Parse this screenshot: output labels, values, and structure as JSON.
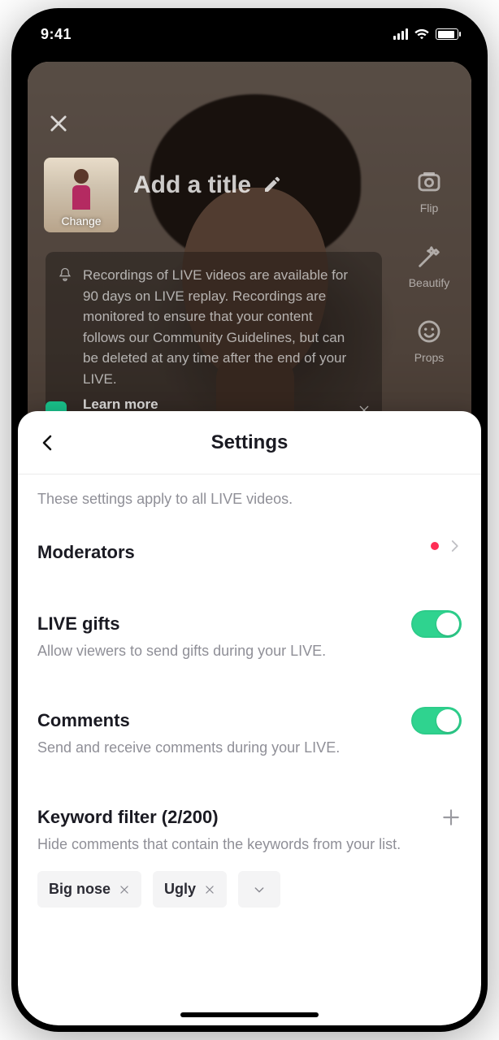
{
  "statusbar": {
    "time": "9:41"
  },
  "camera": {
    "thumb_label": "Change",
    "title_placeholder": "Add a title",
    "tools": {
      "flip": "Flip",
      "beautify": "Beautify",
      "props": "Props"
    },
    "notice": {
      "text": "Recordings of LIVE videos are available for 90 days on LIVE replay. Recordings are monitored to ensure that your content follows our Community Guidelines, but can be deleted at any time after the end of your LIVE.",
      "learn_more": "Learn more"
    }
  },
  "sheet": {
    "title": "Settings",
    "subtext": "These settings apply to all LIVE videos.",
    "moderators": {
      "label": "Moderators"
    },
    "gifts": {
      "label": "LIVE gifts",
      "desc": "Allow viewers to send gifts during your LIVE.",
      "on": true
    },
    "comments": {
      "label": "Comments",
      "desc": "Send and receive comments during your LIVE.",
      "on": true
    },
    "keyword": {
      "label": "Keyword filter (2/200)",
      "desc": "Hide comments that contain the keywords from your list.",
      "chips": [
        "Big nose",
        "Ugly"
      ]
    }
  }
}
